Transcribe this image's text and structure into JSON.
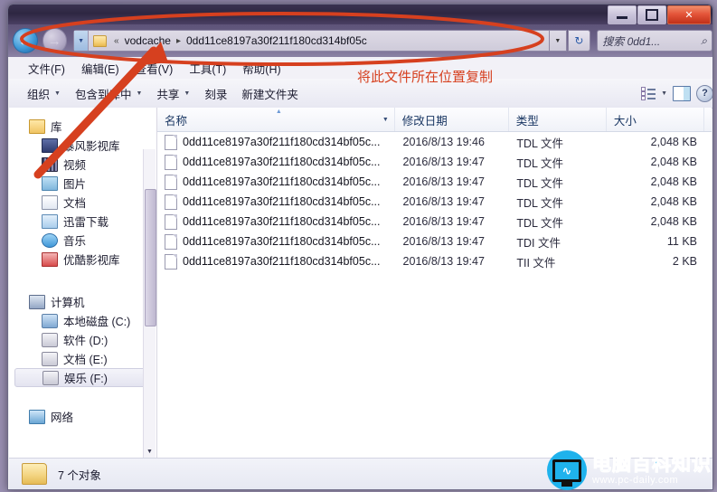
{
  "window": {
    "controls": {
      "minimize_label": "–",
      "maximize_label": "□",
      "close_label": "✕"
    }
  },
  "address_bar": {
    "back_label": "←",
    "forward_label": "→",
    "overflow_label": "«",
    "crumb1": "vodcache",
    "separator": "▸",
    "crumb2": "0dd11ce8197a30f211f180cd314bf05c",
    "dropdown_label": "▼",
    "refresh_label": "↻"
  },
  "search": {
    "placeholder": "搜索 0dd1...",
    "icon_label": "⌕"
  },
  "menu": {
    "items": [
      {
        "label": "文件(F)"
      },
      {
        "label": "编辑(E)"
      },
      {
        "label": "查看(V)"
      },
      {
        "label": "工具(T)"
      },
      {
        "label": "帮助(H)"
      }
    ]
  },
  "toolbar": {
    "items": [
      {
        "label": "组织",
        "caret": "▼"
      },
      {
        "label": "包含到库中",
        "caret": "▼"
      },
      {
        "label": "共享",
        "caret": "▼"
      },
      {
        "label": "刻录",
        "caret": ""
      },
      {
        "label": "新建文件夹",
        "caret": ""
      }
    ],
    "view_caret": "▼",
    "help_label": "?"
  },
  "nav_pane": {
    "libraries": {
      "root": {
        "label": "库",
        "icon": "library-icon"
      },
      "items": [
        {
          "label": "暴风影视库",
          "icon": "baofeng-library-icon"
        },
        {
          "label": "视频",
          "icon": "video-icon"
        },
        {
          "label": "图片",
          "icon": "pictures-icon"
        },
        {
          "label": "文档",
          "icon": "documents-icon"
        },
        {
          "label": "迅雷下载",
          "icon": "thunder-download-icon"
        },
        {
          "label": "音乐",
          "icon": "music-icon"
        },
        {
          "label": "优酷影视库",
          "icon": "youku-library-icon"
        }
      ]
    },
    "computer": {
      "root": {
        "label": "计算机",
        "icon": "computer-icon"
      },
      "items": [
        {
          "label": "本地磁盘 (C:)",
          "icon": "system-drive-icon",
          "selected": false
        },
        {
          "label": "软件 (D:)",
          "icon": "drive-icon",
          "selected": false
        },
        {
          "label": "文档 (E:)",
          "icon": "drive-icon",
          "selected": false
        },
        {
          "label": "娱乐 (F:)",
          "icon": "drive-icon",
          "selected": true
        }
      ]
    },
    "network": {
      "label": "网络",
      "icon": "network-icon"
    },
    "scroll_down_label": "▼"
  },
  "file_list": {
    "columns": [
      {
        "key": "name",
        "label": "名称",
        "sorted": true,
        "sort_mark": "▲",
        "caret": "▼"
      },
      {
        "key": "date",
        "label": "修改日期"
      },
      {
        "key": "type",
        "label": "类型"
      },
      {
        "key": "size",
        "label": "大小"
      }
    ],
    "rows": [
      {
        "name": "0dd11ce8197a30f211f180cd314bf05c...",
        "date": "2016/8/13 19:46",
        "type": "TDL 文件",
        "size": "2,048 KB"
      },
      {
        "name": "0dd11ce8197a30f211f180cd314bf05c...",
        "date": "2016/8/13 19:47",
        "type": "TDL 文件",
        "size": "2,048 KB"
      },
      {
        "name": "0dd11ce8197a30f211f180cd314bf05c...",
        "date": "2016/8/13 19:47",
        "type": "TDL 文件",
        "size": "2,048 KB"
      },
      {
        "name": "0dd11ce8197a30f211f180cd314bf05c...",
        "date": "2016/8/13 19:47",
        "type": "TDL 文件",
        "size": "2,048 KB"
      },
      {
        "name": "0dd11ce8197a30f211f180cd314bf05c...",
        "date": "2016/8/13 19:47",
        "type": "TDL 文件",
        "size": "2,048 KB"
      },
      {
        "name": "0dd11ce8197a30f211f180cd314bf05c...",
        "date": "2016/8/13 19:47",
        "type": "TDI 文件",
        "size": "11 KB"
      },
      {
        "name": "0dd11ce8197a30f211f180cd314bf05c...",
        "date": "2016/8/13 19:47",
        "type": "TII 文件",
        "size": "2 KB"
      }
    ]
  },
  "status_bar": {
    "item_count": "7 个对象"
  },
  "annotation": {
    "text": "将此文件所在位置复制",
    "color": "#d6401f"
  },
  "watermark": {
    "cn": "电脑百科知识",
    "url": "www.pc-daily.com",
    "accent": "#1fb2ec",
    "wave": "∿"
  }
}
